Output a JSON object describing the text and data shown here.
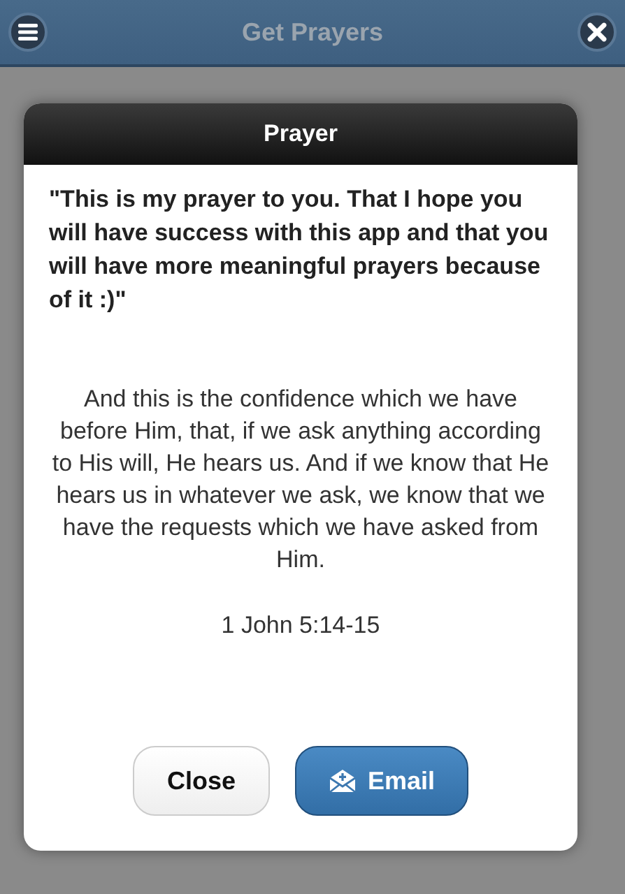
{
  "header": {
    "title": "Get Prayers"
  },
  "dialog": {
    "title": "Prayer",
    "message": "\"This is my prayer to you. That I hope you will have success with this app and that you will have more meaningful prayers because of it :)\"",
    "verse": "And this is the confidence which we have before Him, that, if we ask anything according to His will, He hears us. And if we know that He hears us in whatever we ask, we know that we have the requests which we have asked from Him.",
    "reference": "1 John 5:14-15",
    "buttons": [
      {
        "label": "Close",
        "kind": "plain"
      },
      {
        "label": "Email",
        "kind": "email"
      }
    ]
  }
}
